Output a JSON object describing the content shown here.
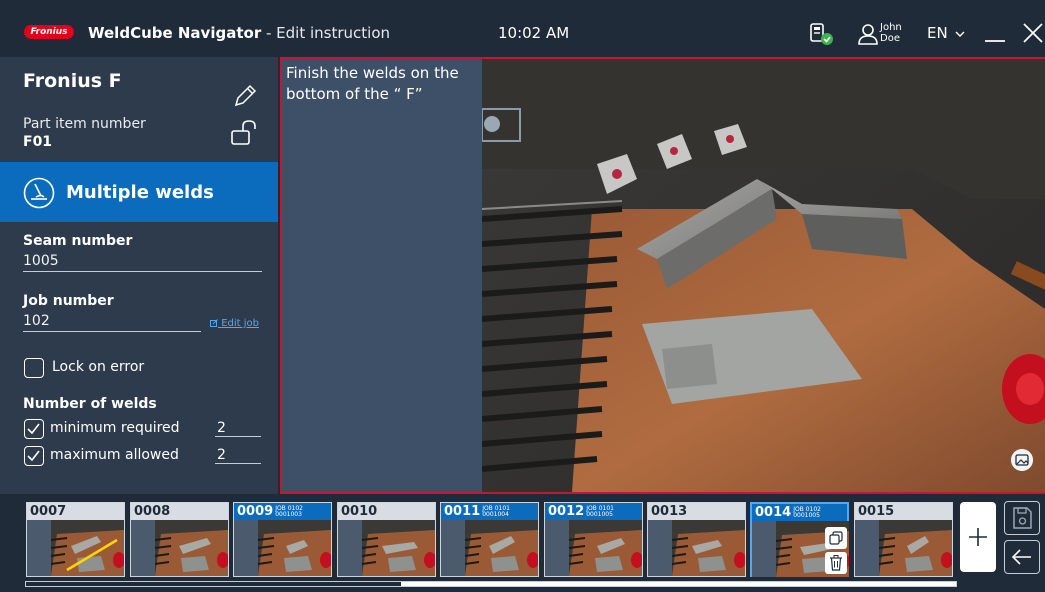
{
  "header": {
    "brand": "Fronius",
    "app_name": "WeldCube Navigator",
    "separator": " - ",
    "screen": "Edit instruction",
    "time": "10:02 AM",
    "user_first": "John",
    "user_last": "Doe",
    "language": "EN"
  },
  "part": {
    "name": "Fronius F",
    "item_label": "Part item number",
    "item_number": "F01"
  },
  "mode": {
    "label": "Multiple welds"
  },
  "fields": {
    "seam_label": "Seam number",
    "seam_value": "1005",
    "job_label": "Job number",
    "job_value": "102",
    "edit_job": "Edit job",
    "lock_label": "Lock on error",
    "welds_label": "Number of welds",
    "min_label": "minimum required",
    "min_value": "2",
    "max_label": "maximum allowed",
    "max_value": "2"
  },
  "instruction": {
    "text": "Finish the welds on the bottom of the “ F”"
  },
  "thumbnails": [
    {
      "id": "0007",
      "job": "",
      "code": "",
      "highlight": false,
      "selected": false
    },
    {
      "id": "0008",
      "job": "",
      "code": "",
      "highlight": false,
      "selected": false
    },
    {
      "id": "0009",
      "job": "JOB 0102",
      "code": "0001003",
      "highlight": true,
      "selected": false
    },
    {
      "id": "0010",
      "job": "",
      "code": "",
      "highlight": false,
      "selected": false
    },
    {
      "id": "0011",
      "job": "JOB 0101",
      "code": "0001004",
      "highlight": true,
      "selected": false
    },
    {
      "id": "0012",
      "job": "JOB 0101",
      "code": "0001005",
      "highlight": true,
      "selected": false
    },
    {
      "id": "0013",
      "job": "",
      "code": "",
      "highlight": false,
      "selected": false
    },
    {
      "id": "0014",
      "job": "JOB 0102",
      "code": "0001005",
      "highlight": true,
      "selected": true
    },
    {
      "id": "0015",
      "job": "",
      "code": "",
      "highlight": false,
      "selected": false
    }
  ],
  "colors": {
    "background": "#1f2b39",
    "sidebar": "#2d3b4d",
    "accent_blue": "#0b6cbd",
    "brand_red": "#e2001a",
    "selection_border": "#c8162c",
    "status_green": "#3cb44a"
  }
}
